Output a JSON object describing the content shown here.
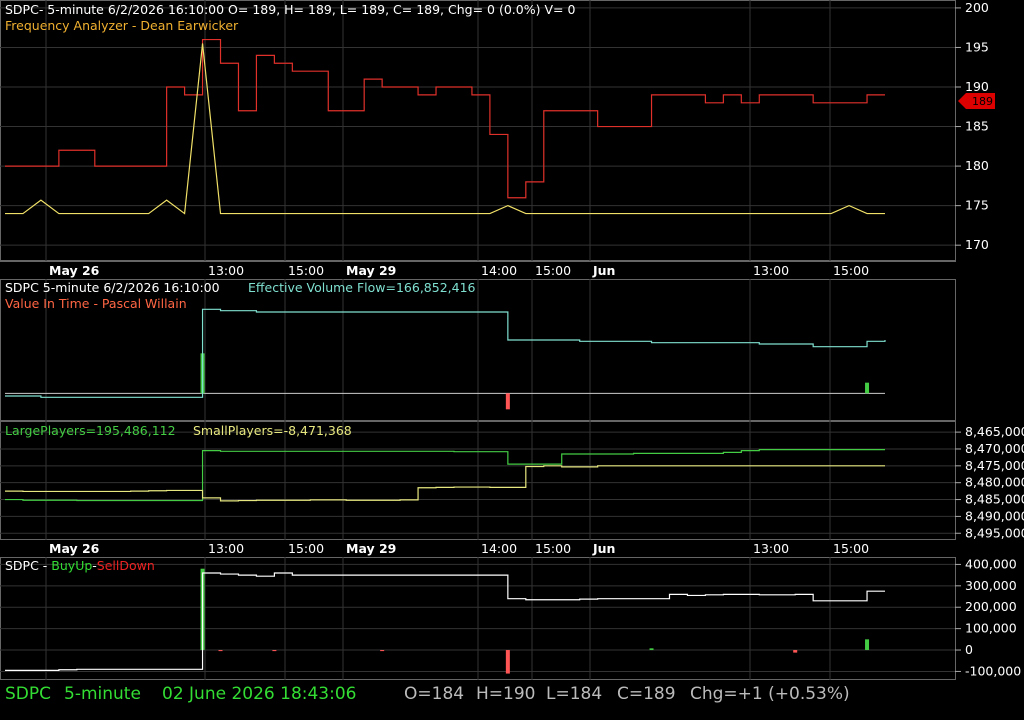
{
  "colors": {
    "background": "#000000",
    "grid": "#333333",
    "axis_text": "#ffffff",
    "price_line": "#e0302a",
    "freq_line": "#f0e068",
    "price_tag": "#dd0000",
    "evf_line": "#7fe0d0",
    "vit_bar_pos": "#44cc44",
    "vit_bar_neg": "#ff5555",
    "large_players": "#44cc44",
    "small_players": "#e8e880",
    "buyup_line": "#ffffff",
    "buy_color": "#33dd33",
    "sell_color": "#ee2222",
    "footer_green": "#33dd33",
    "footer_gray": "#bbbbbb",
    "orange": "#f0b030"
  },
  "panel1": {
    "header_line1": "SDPC- 5-minute 6/2/2026 16:10:00 O= 189, H= 189, L= 189, C= 189, Chg= 0 (0.0%) V= 0",
    "header_line2": "Frequency Analyzer - Dean Earwicker",
    "last_price_tag": "189"
  },
  "panel2": {
    "header_left": "SDPC 5-minute  6/2/2026 16:10:00",
    "header_indicator": "Effective Volume Flow=166,852,416",
    "header_line2": "Value In Time - Pascal Willain"
  },
  "panel3": {
    "large_label": "LargePlayers=195,486,112",
    "small_label": "SmallPlayers=-8,471,368"
  },
  "panel4": {
    "prefix": "SDPC - ",
    "buy_label": "BuyUp",
    "sep": "-",
    "sell_label": "SellDown"
  },
  "time_axis": [
    {
      "label": "May 26",
      "bold": true,
      "grid": true
    },
    {
      "label": "13:00",
      "bold": false,
      "grid": true
    },
    {
      "label": "15:00",
      "bold": false,
      "grid": true
    },
    {
      "label": "May 29",
      "bold": true,
      "grid": true
    },
    {
      "label": "14:00",
      "bold": false,
      "grid": true
    },
    {
      "label": "15:00",
      "bold": false,
      "grid": true
    },
    {
      "label": "Jun",
      "bold": true,
      "grid": true
    },
    {
      "label": "13:00",
      "bold": false,
      "grid": true
    },
    {
      "label": "15:00",
      "bold": false,
      "grid": true
    }
  ],
  "footer": {
    "symbol": "SDPC",
    "interval": "5-minute",
    "datetime": "02 June 2026 18:43:06",
    "open": "O=184",
    "high": "H=190",
    "low": "L=184",
    "close": "C=189",
    "change": "Chg=+1 (+0.53%)"
  },
  "chart_data": [
    {
      "type": "line",
      "panel": "price",
      "y_axis_ticks": [
        170,
        175,
        180,
        185,
        190,
        195,
        200
      ],
      "ylim": [
        168,
        201
      ],
      "series": [
        {
          "name": "Frequency Analyzer - Dean Earwicker",
          "values": [
            180,
            180,
            180,
            182,
            182,
            180,
            180,
            180,
            180,
            190,
            189,
            196,
            193,
            187,
            194,
            193,
            192,
            192,
            187,
            187,
            191,
            190,
            190,
            189,
            190,
            190,
            189,
            184,
            176,
            178,
            187,
            187,
            187,
            185,
            185,
            185,
            189,
            189,
            189,
            188,
            189,
            188,
            189,
            189,
            189,
            188,
            188,
            188,
            189,
            189
          ]
        },
        {
          "values": [
            174,
            174,
            175.7,
            174,
            174,
            174,
            174,
            174,
            174,
            175.7,
            174,
            195.5,
            174,
            174,
            174,
            174,
            174,
            174,
            174,
            174,
            174,
            174,
            174,
            174,
            174,
            174,
            174,
            174,
            175,
            174,
            174,
            174,
            174,
            174,
            174,
            174,
            174,
            174,
            174,
            174,
            174,
            174,
            174,
            174,
            174,
            174,
            174,
            175,
            174,
            174
          ]
        }
      ]
    },
    {
      "type": "line",
      "panel": "value_in_time",
      "series": [
        {
          "name": "Effective Volume Flow",
          "values": [
            -2,
            -2,
            -3,
            -3,
            -3,
            -3,
            -3,
            -3,
            -3,
            -3,
            -3,
            63,
            62,
            62,
            61,
            61,
            61,
            61,
            61,
            61,
            61,
            61,
            61,
            61,
            61,
            61,
            61,
            61,
            40,
            40,
            40,
            40,
            39,
            39,
            39,
            39,
            38,
            38,
            38,
            38,
            38,
            38,
            37,
            37,
            37,
            35,
            35,
            35,
            39,
            40
          ]
        },
        {
          "values": [
            0,
            0,
            0,
            0,
            0,
            0,
            0,
            0,
            0,
            0,
            0,
            30,
            0,
            0,
            0,
            0,
            0,
            0,
            0,
            0,
            0,
            0,
            0,
            0,
            0,
            0,
            0,
            0,
            -12,
            0,
            0,
            0,
            0,
            0,
            0,
            0,
            0,
            0,
            0,
            0,
            0,
            0,
            0,
            0,
            0,
            0,
            0,
            0,
            8,
            0
          ]
        }
      ]
    },
    {
      "type": "line",
      "panel": "players",
      "y_axis_ticks": [
        -8465000,
        -8470000,
        -8475000,
        -8480000,
        -8485000,
        -8490000,
        -8495000
      ],
      "y_tick_labels": [
        "8,465,000",
        "8,470,000",
        "8,475,000",
        "8,480,000",
        "8,485,000",
        "8,490,000",
        "8,495,000"
      ],
      "ylim": [
        -8497000,
        -8462000
      ],
      "series": [
        {
          "name": "LargePlayers",
          "values": [
            -8485000,
            -8485200,
            -8485200,
            -8485200,
            -8485300,
            -8485300,
            -8485300,
            -8485300,
            -8485300,
            -8485300,
            -8485300,
            -8470500,
            -8470700,
            -8470700,
            -8470700,
            -8470700,
            -8470700,
            -8470700,
            -8470700,
            -8470700,
            -8470700,
            -8470700,
            -8470700,
            -8470700,
            -8470700,
            -8470800,
            -8470800,
            -8470800,
            -8474500,
            -8474500,
            -8474500,
            -8471500,
            -8471500,
            -8471500,
            -8471500,
            -8471300,
            -8471300,
            -8471300,
            -8471300,
            -8471300,
            -8471000,
            -8470500,
            -8470200,
            -8470200,
            -8470200,
            -8470200,
            -8470200,
            -8470200,
            -8470200,
            -8470200
          ]
        },
        {
          "name": "SmallPlayers",
          "values": [
            -8482500,
            -8482600,
            -8482600,
            -8482600,
            -8482600,
            -8482600,
            -8482600,
            -8482500,
            -8482400,
            -8482300,
            -8482300,
            -8484500,
            -8485400,
            -8485300,
            -8485200,
            -8485200,
            -8485200,
            -8485100,
            -8485100,
            -8485200,
            -8485200,
            -8485200,
            -8485100,
            -8481500,
            -8481400,
            -8481300,
            -8481300,
            -8481400,
            -8481400,
            -8475200,
            -8475000,
            -8475300,
            -8475300,
            -8475000,
            -8475000,
            -8475000,
            -8475000,
            -8475000,
            -8475000,
            -8475000,
            -8475000,
            -8475000,
            -8475000,
            -8475000,
            -8475000,
            -8475000,
            -8475000,
            -8475000,
            -8475000,
            -8475000
          ]
        }
      ]
    },
    {
      "type": "line",
      "panel": "buyup_selldown",
      "y_axis_ticks": [
        400000,
        300000,
        200000,
        100000,
        0,
        -100000
      ],
      "y_tick_labels": [
        "400,000",
        "300,000",
        "200,000",
        "100,000",
        "0",
        "-100,000"
      ],
      "ylim": [
        -140000,
        430000
      ],
      "series": [
        {
          "name": "BuyUp-SellDown",
          "values": [
            -95000,
            -95000,
            -95000,
            -92000,
            -90000,
            -90000,
            -90000,
            -90000,
            -90000,
            -90000,
            -90000,
            360000,
            355000,
            350000,
            345000,
            360000,
            350000,
            350000,
            350000,
            350000,
            350000,
            350000,
            350000,
            350000,
            350000,
            350000,
            350000,
            350000,
            240000,
            235000,
            235000,
            235000,
            238000,
            240000,
            240000,
            240000,
            240000,
            260000,
            255000,
            258000,
            260000,
            260000,
            258000,
            258000,
            260000,
            230000,
            230000,
            230000,
            275000,
            275000
          ]
        },
        {
          "values": [
            0,
            0,
            0,
            0,
            0,
            0,
            0,
            0,
            0,
            0,
            0,
            380000,
            -5000,
            0,
            0,
            -5000,
            0,
            0,
            0,
            0,
            0,
            -5000,
            0,
            0,
            0,
            0,
            0,
            0,
            -110000,
            0,
            0,
            0,
            0,
            0,
            0,
            0,
            8000,
            0,
            0,
            0,
            0,
            0,
            0,
            0,
            -12000,
            0,
            0,
            0,
            50000,
            0
          ]
        }
      ]
    }
  ]
}
